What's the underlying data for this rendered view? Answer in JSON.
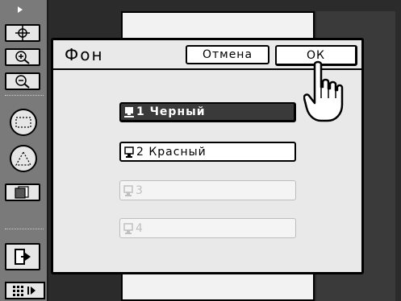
{
  "dialog": {
    "title": "Фон",
    "cancel_label": "Отмена",
    "ok_label": "ОК",
    "options": [
      {
        "label": "1  Черный",
        "state": "selected"
      },
      {
        "label": "2  Красный",
        "state": "normal"
      },
      {
        "label": "3",
        "state": "disabled"
      },
      {
        "label": "4",
        "state": "disabled"
      }
    ]
  },
  "toolbar": {
    "icons": [
      "move-icon",
      "zoom-in-icon",
      "zoom-out-icon",
      "select-rect-icon",
      "select-free-icon",
      "copy-page-icon",
      "exit-icon",
      "keypad-icon"
    ]
  },
  "colors": {
    "selected_bg": "#3a3a3a",
    "dialog_bg": "#e9e9e9",
    "toolbar_bg": "#7a7a7a"
  }
}
